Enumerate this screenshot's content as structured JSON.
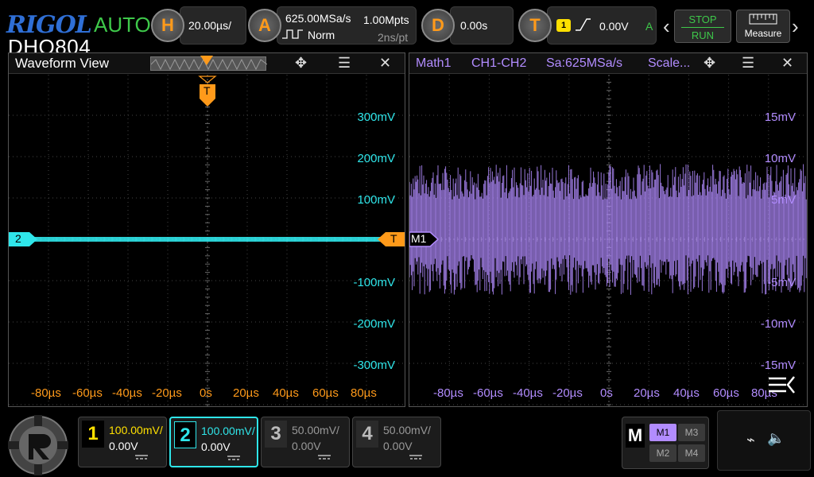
{
  "brand": {
    "name": "RIGOL",
    "mode": "AUTO",
    "model": "DHO804"
  },
  "horizontal": {
    "key": "H",
    "timebase": "20.00µs/"
  },
  "acquire": {
    "key": "A",
    "sample_rate": "625.00MSa/s",
    "memory": "1.00Mpts",
    "trigger_mode": "Norm",
    "resolution": "2ns/pt"
  },
  "delay": {
    "key": "D",
    "value": "0.00s"
  },
  "trigger": {
    "key": "T",
    "source": "1",
    "level": "0.00V",
    "coupling_indicator": "A"
  },
  "controls": {
    "stop": "STOP",
    "run": "RUN",
    "measure": "Measure"
  },
  "left_pane": {
    "title": "Waveform View",
    "trigger_marker": "T",
    "channel_marker": "2",
    "level_marker": "T",
    "y_labels": [
      "300mV",
      "200mV",
      "100mV",
      "-100mV",
      "-200mV",
      "-300mV"
    ],
    "x_labels": [
      "-80µs",
      "-60µs",
      "-40µs",
      "-20µs",
      "0s",
      "20µs",
      "40µs",
      "60µs",
      "80µs"
    ]
  },
  "right_pane": {
    "title": "Math1",
    "operation": "CH1-CH2",
    "sample_rate": "Sa:625MSa/s",
    "scale_label": "Scale...",
    "marker": "M1",
    "y_labels": [
      "15mV",
      "10mV",
      "5mV",
      "-5mV",
      "-10mV",
      "-15mV"
    ],
    "x_labels": [
      "-80µs",
      "-60µs",
      "-40µs",
      "-20µs",
      "0s",
      "20µs",
      "40µs",
      "60µs",
      "80µs"
    ]
  },
  "channels": [
    {
      "num": "1",
      "scale": "100.00mV/",
      "offset": "0.00V",
      "coupling": "DC",
      "color": "#ffe000",
      "active": false
    },
    {
      "num": "2",
      "scale": "100.00mV/",
      "offset": "0.00V",
      "coupling": "DC",
      "color": "#2fe6ea",
      "active": true
    },
    {
      "num": "3",
      "scale": "50.00mV/",
      "offset": "0.00V",
      "coupling": "DC",
      "color": "#8a8a8a",
      "active": false
    },
    {
      "num": "4",
      "scale": "50.00mV/",
      "offset": "0.00V",
      "coupling": "DC",
      "color": "#8a8a8a",
      "active": false
    }
  ],
  "math": {
    "label": "M",
    "m1": "M1",
    "m2": "M2",
    "m3": "M3",
    "m4": "M4"
  },
  "colors": {
    "ch2": "#2fe6ea",
    "math": "#b28cff",
    "trigger": "#ff9a1a",
    "run": "#3ec84a",
    "brand": "#2f6fd6"
  }
}
